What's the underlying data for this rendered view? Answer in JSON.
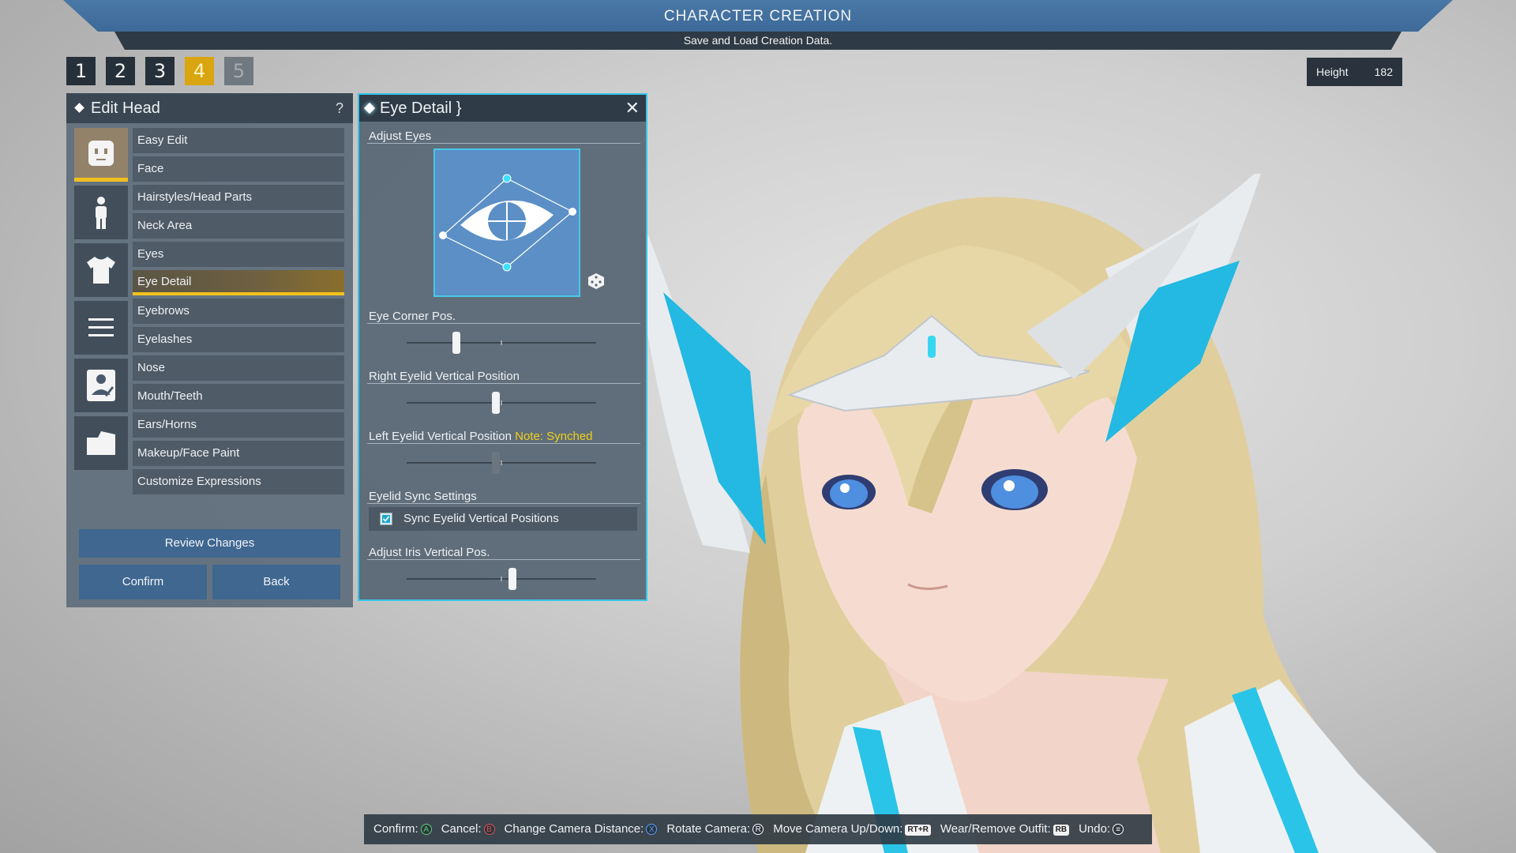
{
  "header": {
    "title": "CHARACTER CREATION",
    "subtitle": "Save and Load Creation Data."
  },
  "steps": [
    {
      "label": "1",
      "state": "done"
    },
    {
      "label": "2",
      "state": "done"
    },
    {
      "label": "3",
      "state": "done"
    },
    {
      "label": "4",
      "state": "active"
    },
    {
      "label": "5",
      "state": "disabled"
    }
  ],
  "height": {
    "label": "Height",
    "value": "182"
  },
  "edit_head": {
    "title": "Edit Head",
    "help_icon": "question-icon",
    "categories": [
      {
        "icon": "face-icon",
        "active": true
      },
      {
        "icon": "body-icon",
        "active": false
      },
      {
        "icon": "outfit-icon",
        "active": false
      },
      {
        "icon": "menu-lines-icon",
        "active": false
      },
      {
        "icon": "profile-card-icon",
        "active": false
      },
      {
        "icon": "save-folder-icon",
        "active": false
      }
    ],
    "items": [
      "Easy Edit",
      "Face",
      "Hairstyles/Head Parts",
      "Neck Area",
      "Eyes",
      "Eye Detail",
      "Eyebrows",
      "Eyelashes",
      "Nose",
      "Mouth/Teeth",
      "Ears/Horns",
      "Makeup/Face Paint",
      "Customize Expressions"
    ],
    "selected": "Eye Detail",
    "review_label": "Review Changes",
    "confirm_label": "Confirm",
    "back_label": "Back"
  },
  "eye_detail": {
    "title": "Eye Detail",
    "adjust_eyes_label": "Adjust Eyes",
    "eye_corner_label": "Eye Corner Pos.",
    "eye_corner_value": 0.25,
    "right_eyelid_label": "Right Eyelid Vertical Position",
    "right_eyelid_value": 0.47,
    "left_eyelid_label": "Left Eyelid Vertical Position",
    "left_eyelid_note": "Note: Synched",
    "left_eyelid_value": 0.47,
    "sync_section_label": "Eyelid Sync Settings",
    "sync_checkbox_label": "Sync Eyelid Vertical Positions",
    "sync_checked": true,
    "iris_label": "Adjust Iris Vertical Pos.",
    "iris_value": 0.56
  },
  "controls": [
    {
      "label": "Confirm:",
      "button": "A"
    },
    {
      "label": "Cancel:",
      "button": "B"
    },
    {
      "label": "Change Camera Distance:",
      "button": "X"
    },
    {
      "label": "Rotate Camera:",
      "button": "R"
    },
    {
      "label": "Move Camera Up/Down:",
      "button": "RT+R"
    },
    {
      "label": "Wear/Remove Outfit:",
      "button": "RB"
    },
    {
      "label": "Undo:",
      "button": "≡"
    }
  ],
  "colors": {
    "accent_gold": "#f2c21c",
    "accent_cyan": "#36c7e8",
    "note_yellow": "#f0d018"
  }
}
